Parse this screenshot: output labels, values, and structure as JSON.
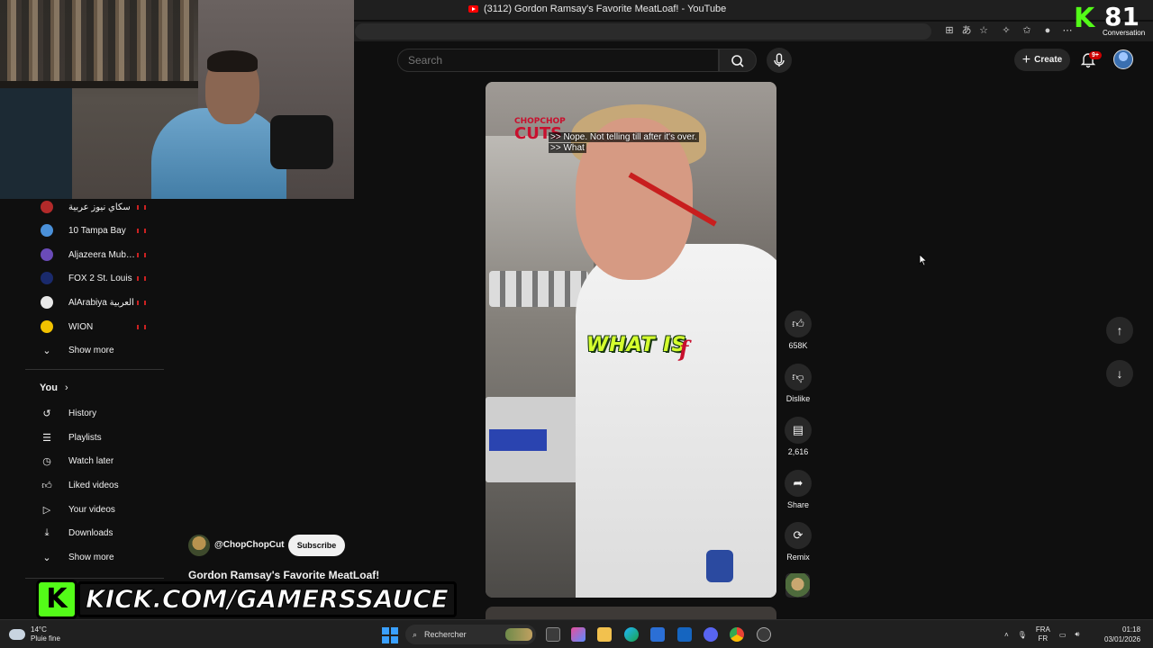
{
  "browser": {
    "tab_title": "(3112) Gordon Ramsay's Favorite MeatLoaf! - YouTube"
  },
  "kick_counter": {
    "count": "81",
    "label": "Conversation"
  },
  "header": {
    "search_placeholder": "Search",
    "create_label": "Create",
    "notification_badge": "9+"
  },
  "sidebar": {
    "channels": [
      {
        "label": "سكاي نيوز عربية",
        "color": "#b22a2a"
      },
      {
        "label": "10 Tampa Bay",
        "color": "#4a90d9"
      },
      {
        "label": "Aljazeera Mubas...",
        "color": "#6a4bb8"
      },
      {
        "label": "FOX 2 St. Louis",
        "color": "#1a2a6c"
      },
      {
        "label": "AlArabiya العربية",
        "color": "#e8e8e8"
      },
      {
        "label": "WION",
        "color": "#f2c200"
      }
    ],
    "show_more_1": "Show more",
    "you_label": "You",
    "you_items": [
      {
        "label": "History",
        "icon": "history-icon"
      },
      {
        "label": "Playlists",
        "icon": "playlists-icon"
      },
      {
        "label": "Watch later",
        "icon": "watch-later-icon"
      },
      {
        "label": "Liked videos",
        "icon": "thumbs-up-icon"
      },
      {
        "label": "Your videos",
        "icon": "play-box-icon"
      },
      {
        "label": "Downloads",
        "icon": "download-icon"
      }
    ],
    "show_more_2": "Show more"
  },
  "short": {
    "caption_lines": [
      "",
      ">> Nope. Not telling till after it's over.",
      ">> What"
    ],
    "logo_top": "CHOPCHOP",
    "logo_bottom": "CUTS",
    "overlay_text": "WHAT IS",
    "overlay_f": "f"
  },
  "actions": {
    "like_count": "658K",
    "dislike_label": "Dislike",
    "comments_count": "2,616",
    "share_label": "Share",
    "remix_label": "Remix"
  },
  "channel": {
    "name": "@ChopChopCut",
    "subscribe_label": "Subscribe",
    "video_title": "Gordon Ramsay's Favorite MeatLoaf!"
  },
  "kick_banner": {
    "k": "K",
    "text": "KICK.COM/GAMERSSAUCE"
  },
  "taskbar": {
    "temp": "14°C",
    "weather": "Pluie fine",
    "search_label": "Rechercher",
    "lang_top": "FRA",
    "lang_bottom": "FR",
    "time": "01:18",
    "date": "03/01/2026"
  }
}
